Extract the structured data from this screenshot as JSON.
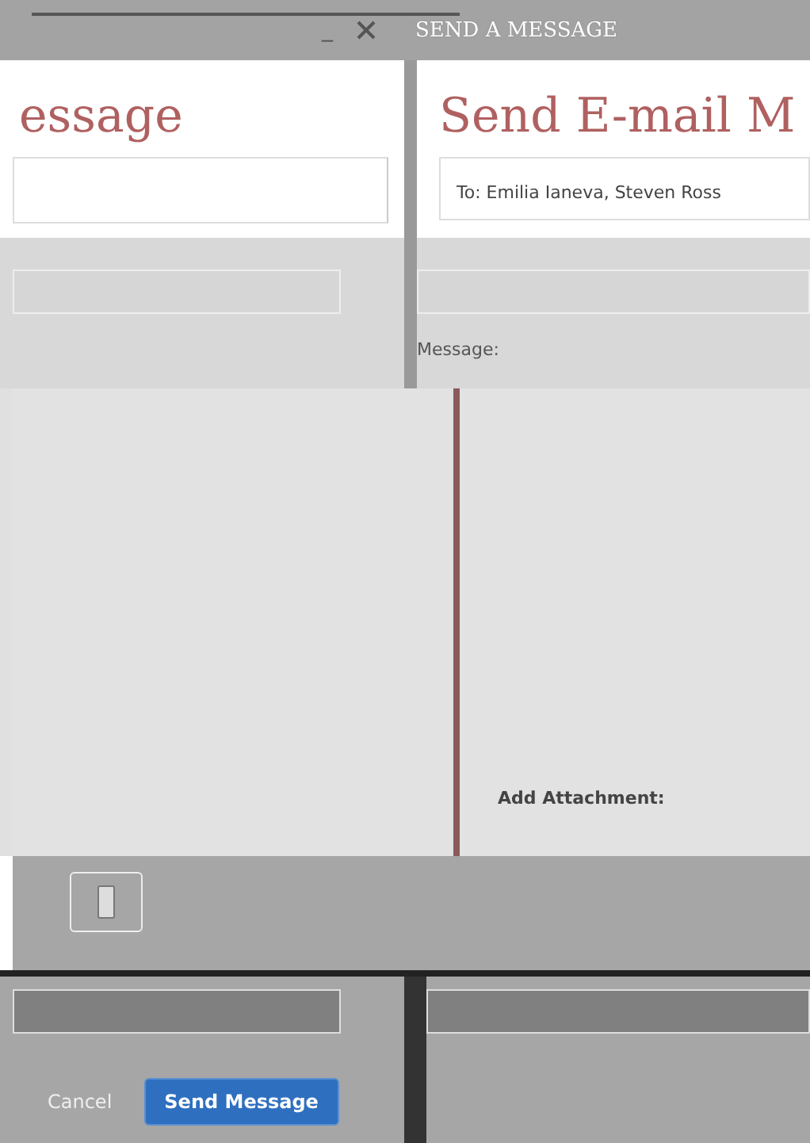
{
  "window": {
    "title": "SEND A MESSAGE",
    "minimize": "_"
  },
  "left_panel": {
    "heading": "essage"
  },
  "right_panel": {
    "heading": "Send E-mail M",
    "recipients": "To:  Emilia Ianeva, Steven Ross",
    "message_label": "Message:",
    "attachment_label": "Add Attachment:"
  },
  "buttons": {
    "cancel": "Cancel",
    "send": "Send Message"
  }
}
